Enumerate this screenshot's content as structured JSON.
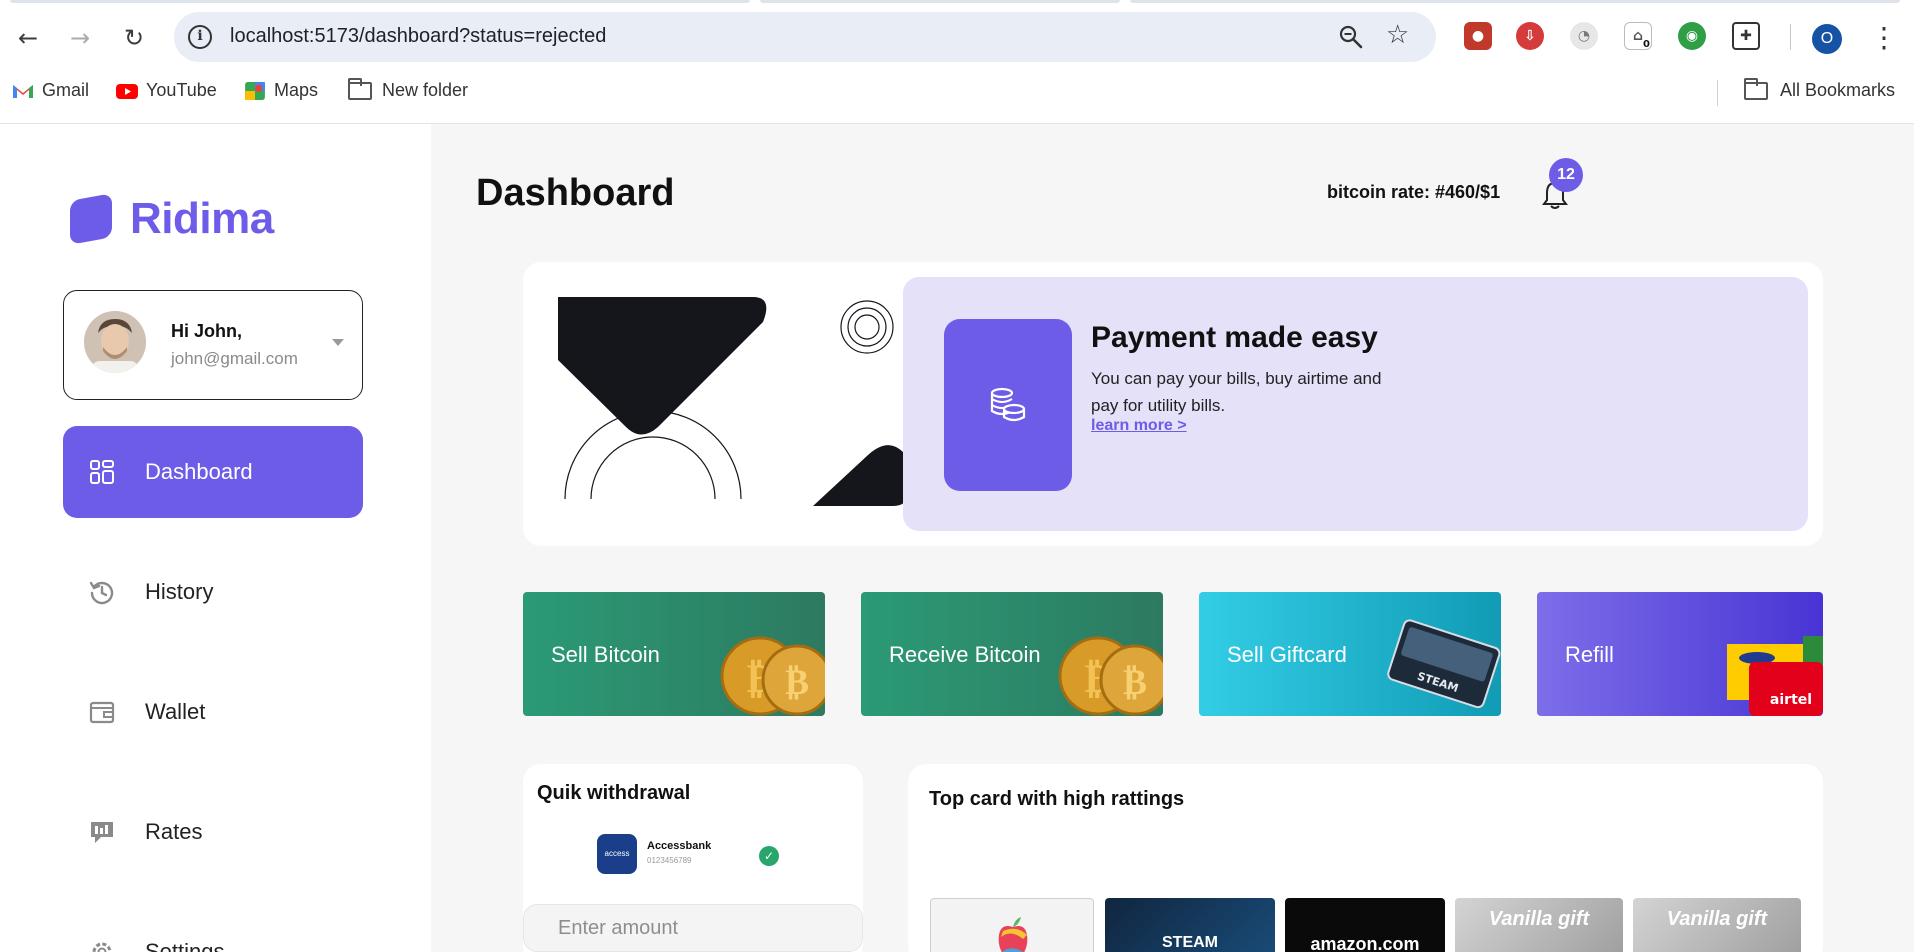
{
  "browser": {
    "url": "localhost:5173/dashboard?status=rejected",
    "profile_initial": "O",
    "ext_badge": "0",
    "bookmarks": [
      "Gmail",
      "YouTube",
      "Maps",
      "New folder"
    ],
    "all_bookmarks": "All Bookmarks"
  },
  "brand": {
    "name": "Ridima",
    "accent": "#6c5ce7"
  },
  "user": {
    "greeting": "Hi John,",
    "email": "john@gmail.com"
  },
  "nav": {
    "dashboard": "Dashboard",
    "history": "History",
    "wallet": "Wallet",
    "rates": "Rates",
    "settings": "Settings"
  },
  "header": {
    "title": "Dashboard",
    "rate": "bitcoin rate: #460/$1",
    "notifications": "12"
  },
  "hero": {
    "title": "Payment made easy",
    "description": "You can pay your bills, buy airtime and pay for utility bills.",
    "link": "learn more >"
  },
  "actions": {
    "sell_bitcoin": "Sell Bitcoin",
    "receive_bitcoin": "Receive Bitcoin",
    "sell_giftcard": "Sell Giftcard",
    "refill": "Refill"
  },
  "withdrawal": {
    "title": "Quik withdrawal",
    "bank_name": "Accessbank",
    "account_number": "0123456789",
    "bank_logo_text": "access",
    "amount_placeholder": "Enter amount"
  },
  "top_cards": {
    "title": "Top card with high rattings",
    "cards": [
      "STEAM",
      "amazon.com",
      "Vanilla gift",
      "Vanilla gift"
    ]
  }
}
